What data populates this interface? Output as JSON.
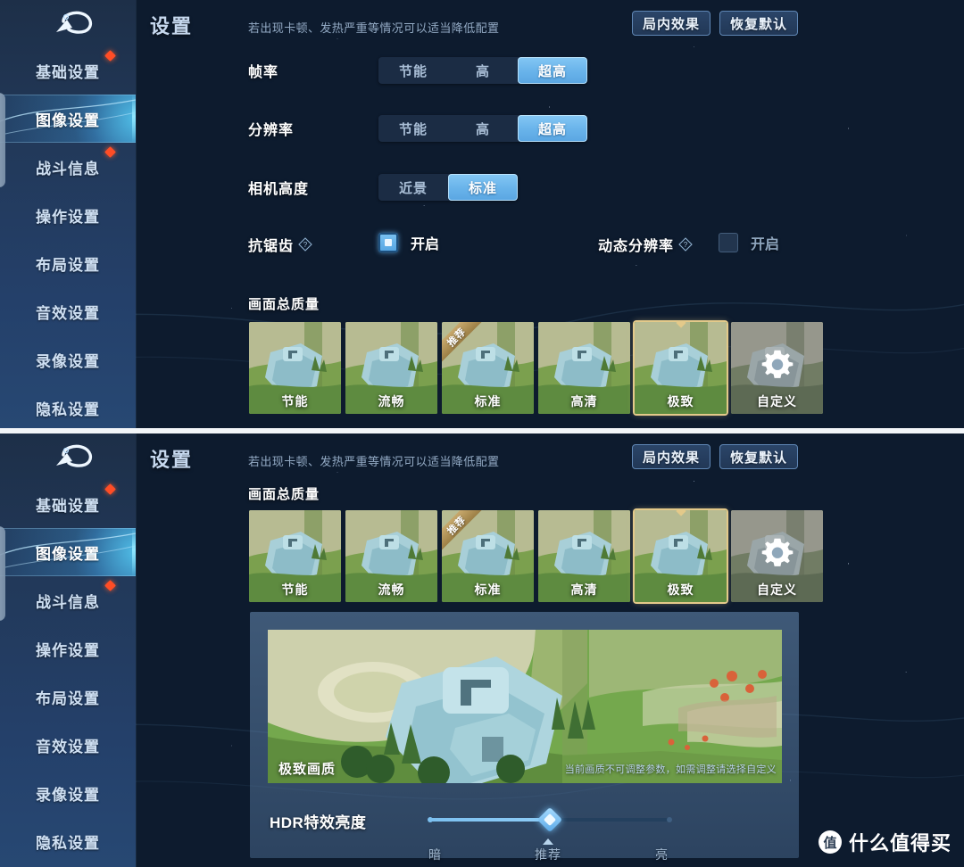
{
  "app": {
    "title": "设置",
    "hint": "若出现卡顿、发热严重等情况可以适当降低配置",
    "logo_icon": "back-swoosh-logo"
  },
  "header_buttons": [
    {
      "label": "局内效果",
      "name": "in-game-effects-button"
    },
    {
      "label": "恢复默认",
      "name": "restore-default-button"
    }
  ],
  "sidebar": {
    "items": [
      {
        "label": "基础设置",
        "badge": true,
        "active": false
      },
      {
        "label": "图像设置",
        "badge": false,
        "active": true
      },
      {
        "label": "战斗信息",
        "badge": true,
        "active": false
      },
      {
        "label": "操作设置",
        "badge": false,
        "active": false
      },
      {
        "label": "布局设置",
        "badge": false,
        "active": false
      },
      {
        "label": "音效设置",
        "badge": false,
        "active": false
      },
      {
        "label": "录像设置",
        "badge": false,
        "active": false
      },
      {
        "label": "隐私设置",
        "badge": false,
        "active": false
      }
    ]
  },
  "settings": {
    "frame_rate": {
      "label": "帧率",
      "options": [
        "节能",
        "高",
        "超高"
      ],
      "selected": "超高"
    },
    "resolution": {
      "label": "分辨率",
      "options": [
        "节能",
        "高",
        "超高"
      ],
      "selected": "超高"
    },
    "camera_height": {
      "label": "相机高度",
      "options": [
        "近景",
        "标准"
      ],
      "selected": "标准"
    },
    "anti_aliasing": {
      "label": "抗锯齿",
      "help_icon": "question-mark-icon",
      "toggle_label": "开启",
      "checked": true
    },
    "dynamic_resolution": {
      "label": "动态分辨率",
      "help_icon": "question-mark-icon",
      "toggle_label": "开启",
      "checked": false
    },
    "overall_quality": {
      "label": "画面总质量",
      "selected": "极致",
      "recommended": "标准",
      "recommended_ribbon": "推荐",
      "presets": [
        {
          "label": "节能",
          "icon": null
        },
        {
          "label": "流畅",
          "icon": null
        },
        {
          "label": "标准",
          "icon": null
        },
        {
          "label": "高清",
          "icon": null
        },
        {
          "label": "极致",
          "icon": null
        },
        {
          "label": "自定义",
          "icon": "gear-icon"
        }
      ]
    },
    "preview": {
      "label": "极致画质",
      "note": "当前画质不可调整参数，如需调整请选择自定义"
    },
    "hdr_brightness": {
      "label": "HDR特效亮度",
      "value_percent": 50,
      "ticks": [
        "暗",
        "推荐",
        "亮"
      ]
    }
  },
  "watermark": {
    "badge": "值",
    "text": "什么值得买"
  },
  "colors": {
    "accent": "#68b3ea",
    "selected_border": "#e3c98a",
    "badge_red": "#ff4d26",
    "panel_bg": "#2b4563"
  }
}
